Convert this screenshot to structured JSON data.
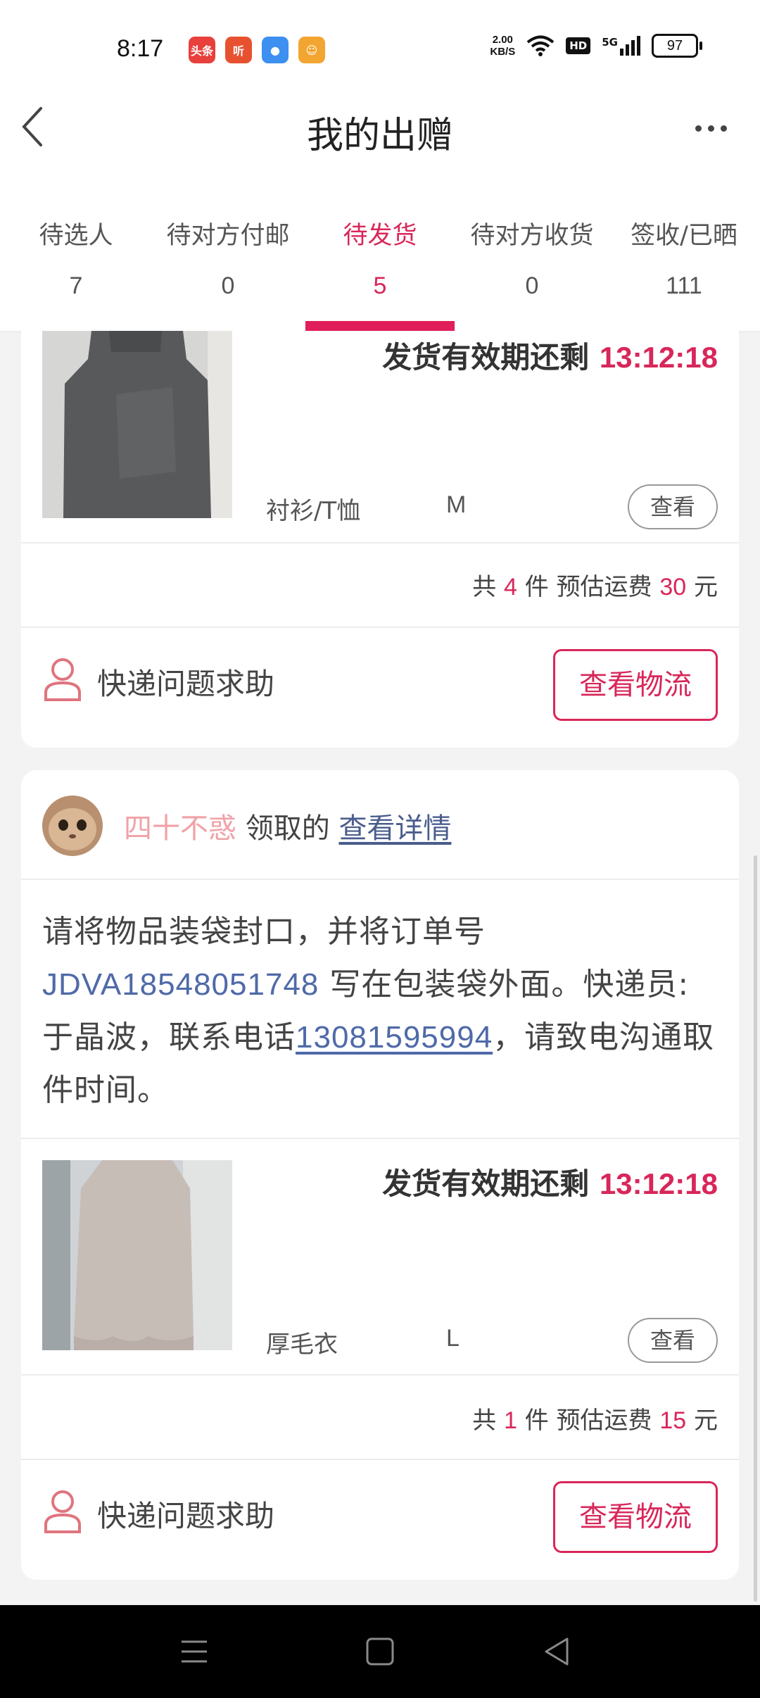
{
  "status_bar": {
    "time": "8:17",
    "app_icons": [
      {
        "name": "toutiao-app-icon",
        "label": "头条",
        "color": "#e8403b"
      },
      {
        "name": "ting-app-icon",
        "label": "听",
        "color": "#e8512f"
      },
      {
        "name": "chat-app-icon",
        "label": "●",
        "color": "#3d8ff0"
      },
      {
        "name": "game-app-icon",
        "label": "☺",
        "color": "#f2a531"
      }
    ],
    "net_speed_value": "2.00",
    "net_speed_unit": "KB/S",
    "hd_label": "HD",
    "signal_label": "5G",
    "battery": "97"
  },
  "header": {
    "title": "我的出赠"
  },
  "tabs": [
    {
      "label": "待选人",
      "count": "7",
      "active": false
    },
    {
      "label": "待对方付邮",
      "count": "0",
      "active": false
    },
    {
      "label": "待发货",
      "count": "5",
      "active": true
    },
    {
      "label": "待对方收货",
      "count": "0",
      "active": false
    },
    {
      "label": "签收/已晒",
      "count": "111",
      "active": false
    }
  ],
  "orders": [
    {
      "deadline_label": "发货有效期还剩",
      "deadline_time": "13:12:18",
      "category": "衬衫/T恤",
      "size": "M",
      "view_label": "查看",
      "summary": {
        "prefix": "共",
        "count": "4",
        "unit": "件 预估运费",
        "fee": "30",
        "currency": "元"
      },
      "help_text": "快递问题求助",
      "logistics_label": "查看物流"
    },
    {
      "receiver_name": "四十不惑",
      "receiver_suffix": "领取的",
      "detail_link": "查看详情",
      "instructions": {
        "part1": "请将物品装袋封口，并将订单号 ",
        "order_no": "JDVA18548051748",
        "part2": " 写在包装袋外面。快递员:于晶波，联系电话",
        "phone": "13081595994",
        "part3": "，请致电沟通取件时间。"
      },
      "deadline_label": "发货有效期还剩",
      "deadline_time": "13:12:18",
      "category": "厚毛衣",
      "size": "L",
      "view_label": "查看",
      "summary": {
        "prefix": "共",
        "count": "1",
        "unit": "件 预估运费",
        "fee": "15",
        "currency": "元"
      },
      "help_text": "快递问题求助",
      "logistics_label": "查看物流"
    }
  ],
  "colors": {
    "accent": "#d8275a",
    "link": "#4f6aa8",
    "receiver": "#f0a2a8"
  }
}
